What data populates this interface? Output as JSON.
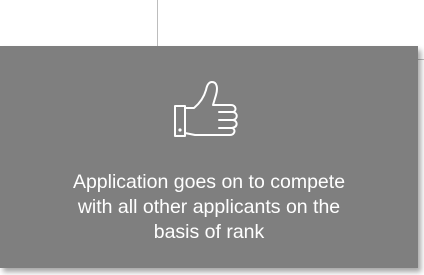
{
  "background_box": {
    "border_color": "#bdbdbd"
  },
  "card": {
    "background_color": "#7f7f7f",
    "text_color": "#ffffff",
    "icon": "thumbs-up-icon",
    "caption_lines": [
      "Application goes on to compete",
      "with all other applicants on the",
      "basis of rank"
    ]
  }
}
